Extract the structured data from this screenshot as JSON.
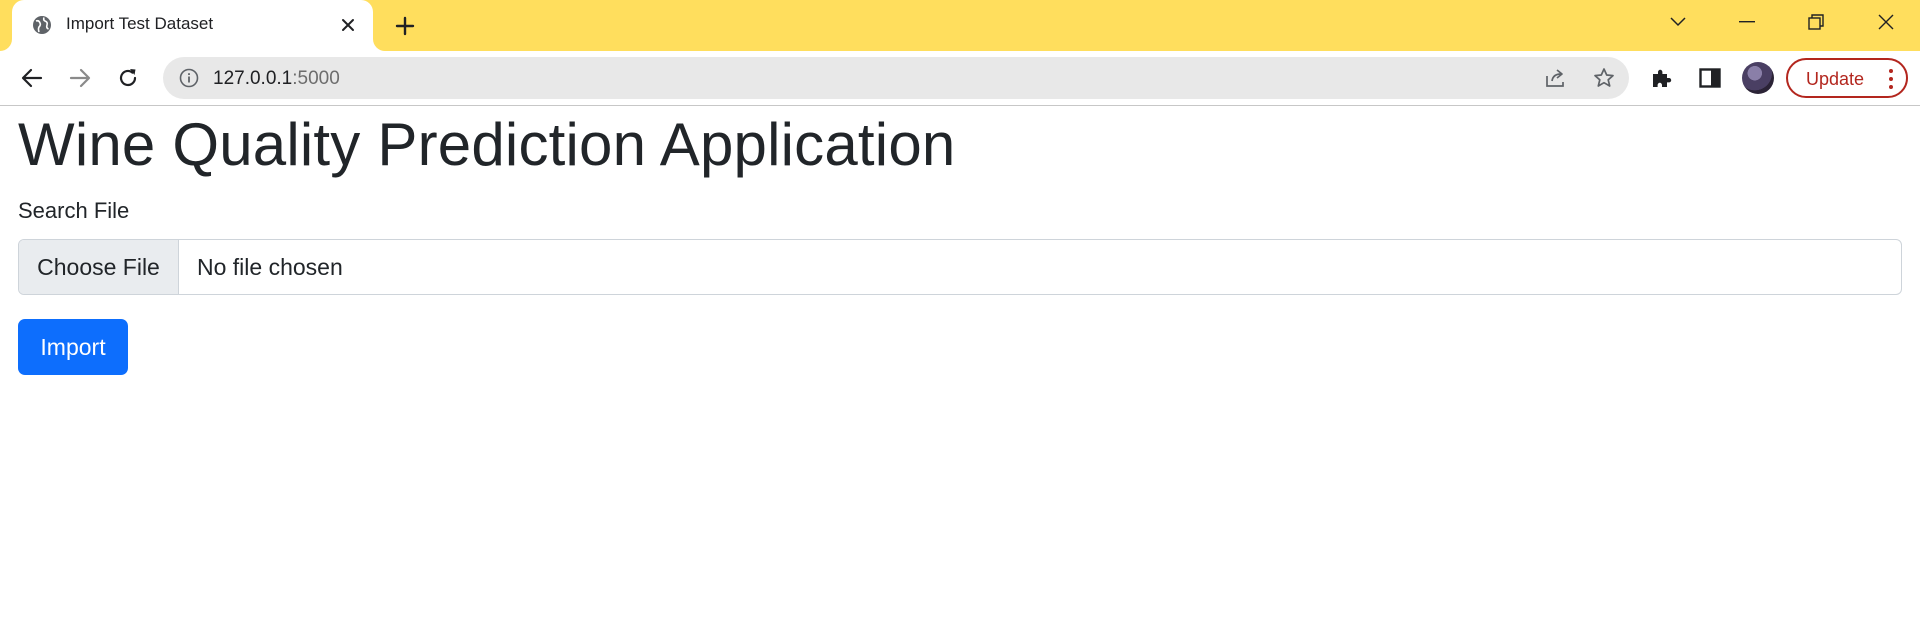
{
  "browser": {
    "tab": {
      "title": "Import Test Dataset",
      "favicon": "globe-icon"
    },
    "new_tab_icon": "plus-icon",
    "window_controls": [
      "chevron-down-icon",
      "minimize-icon",
      "restore-icon",
      "close-icon"
    ],
    "address_bar": {
      "host": "127.0.0.1",
      "port": ":5000",
      "info_icon": "info-icon"
    },
    "update_label": "Update",
    "colors": {
      "tabstrip": "#ffde5d",
      "update_accent": "#b3261e"
    }
  },
  "page": {
    "title": "Wine Quality Prediction Application",
    "file_label": "Search File",
    "choose_file_label": "Choose File",
    "file_status": "No file chosen",
    "import_label": "Import",
    "colors": {
      "primary": "#0d6efd",
      "text": "#212529"
    }
  }
}
